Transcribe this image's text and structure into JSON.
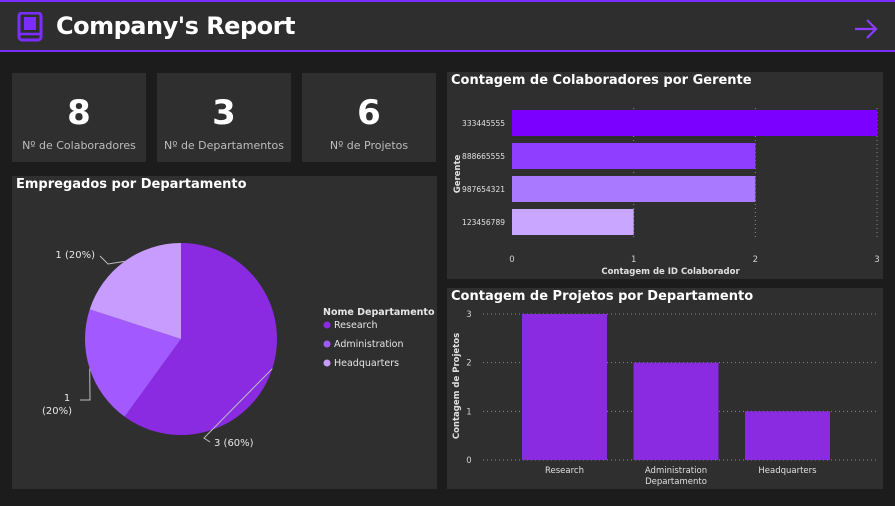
{
  "header": {
    "title": "Company's Report",
    "logo_icon": "book-icon",
    "nav_icon": "arrow-right-icon"
  },
  "colors": {
    "accent": "#7b2cff",
    "primary": "#8a2be2",
    "mid": "#a259ff",
    "light": "#c89bff",
    "panel": "#2f2f2f",
    "background": "#1c1c1c"
  },
  "kpis": [
    {
      "value": "8",
      "label": "Nº de Colaboradores"
    },
    {
      "value": "3",
      "label": "Nº de Departamentos"
    },
    {
      "value": "6",
      "label": "Nº de Projetos"
    }
  ],
  "chart_data": [
    {
      "type": "pie",
      "title": "Empregados por Departamento",
      "legend_title": "Nome Departamento",
      "legend_position": "right",
      "labels": [
        "Research",
        "Administration",
        "Headquarters"
      ],
      "values": [
        3,
        1,
        1
      ],
      "data_labels": [
        "3 (60%)",
        "1 (20%)",
        "1 (20%)"
      ],
      "colors": [
        "#8a2be2",
        "#a259ff",
        "#c89bff"
      ]
    },
    {
      "type": "bar",
      "orientation": "horizontal",
      "title": "Contagem de Colaboradores por Gerente",
      "xlabel": "Contagem de ID Colaborador",
      "ylabel": "Gerente",
      "categories": [
        "333445555",
        "888665555",
        "987654321",
        "123456789"
      ],
      "values": [
        3,
        2,
        2,
        1
      ],
      "xlim": [
        0,
        3
      ],
      "xticks": [
        "0",
        "1",
        "2",
        "3"
      ],
      "grid": true,
      "colors": [
        "#7b00ff",
        "#8f3dff",
        "#a97aff",
        "#c9a6ff"
      ]
    },
    {
      "type": "bar",
      "title": "Contagem de Projetos por Departamento",
      "xlabel": "Departamento",
      "ylabel": "Contagem de Projetos",
      "categories": [
        "Research",
        "Administration",
        "Headquarters"
      ],
      "values": [
        3,
        2,
        1
      ],
      "ylim": [
        0,
        3
      ],
      "yticks": [
        "0",
        "1",
        "2",
        "3"
      ],
      "grid": true,
      "color": "#8a2be2"
    }
  ]
}
